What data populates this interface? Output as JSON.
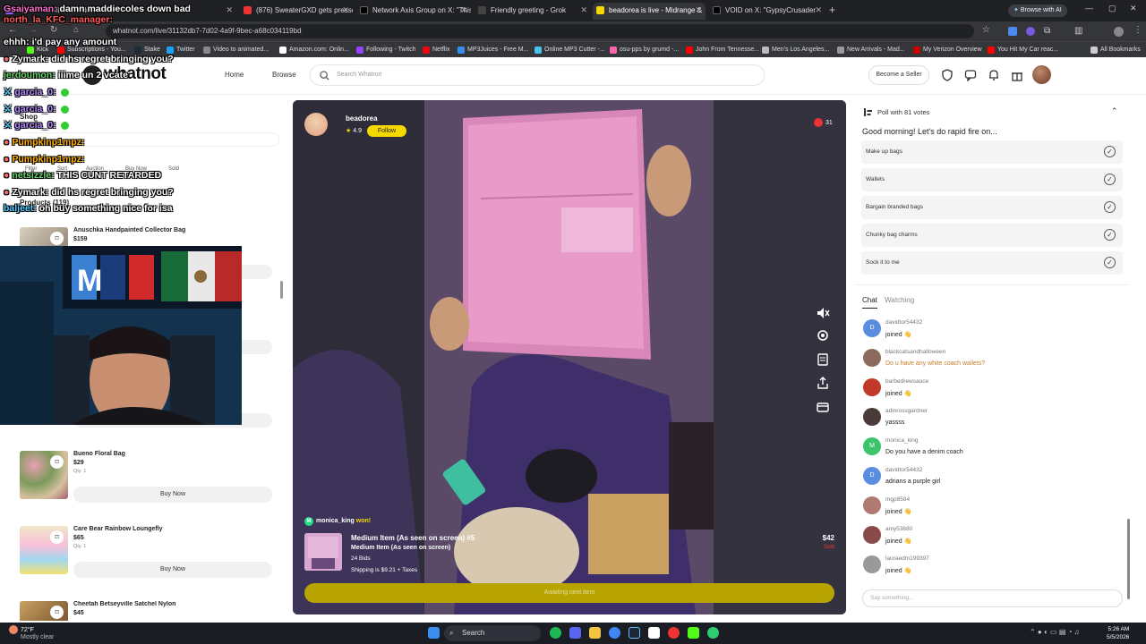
{
  "browser": {
    "tabs": [
      {
        "title": "Watch maddiecoles down bad",
        "color": "#8a5cf6"
      },
      {
        "title": "(876) SweaterGXD gets pressed",
        "color": "#e33"
      },
      {
        "title": "Network Axis Group on X: \"This",
        "color": "#000"
      },
      {
        "title": "Friendly greeting - Grok",
        "color": "#444"
      },
      {
        "title": "beadorea is live - Midrange & ",
        "color": "#f5d800"
      },
      {
        "title": "VOID on X: \"GypsyCrusader",
        "color": "#000"
      }
    ],
    "active_tab": 4,
    "browse_ai": "Browse with AI",
    "url": "whatnot.com/live/31132db7-7d02-4a9f-9bec-a68c034119bd",
    "bookmarks": [
      "Kick",
      "Subscriptions - You...",
      "Stake",
      "Twitter",
      "Video to animated...",
      "Amazon.com: Onlin...",
      "Following - Twitch",
      "Netflix",
      "MP3Juices - Free M...",
      "Online MP3 Cutter -...",
      "osu-pps by grumd -...",
      "John From Tennesse...",
      "Men's Los Angeles...",
      "New Arrivals - Mad...",
      "My Verizon Overview",
      "You Hit My Car reac...",
      "All Bookmarks"
    ]
  },
  "site": {
    "logo": "whatnot",
    "nav": {
      "home": "Home",
      "browse": "Browse"
    },
    "search_placeholder": "Search Whatnot",
    "seller_button": "Become a Seller"
  },
  "left": {
    "shop_label": "Shop",
    "filters": [
      "Filter",
      "Sort",
      "Auction",
      "Buy Now",
      "Sold"
    ],
    "products_count": "Products (119)",
    "products": [
      {
        "name": "Anuschka Handpainted Collector Bag",
        "price": "$159",
        "qty": "",
        "buy": ""
      },
      {
        "name": "Bueno Floral Bag",
        "price": "$29",
        "qty": "Qty. 1",
        "buy": "Buy Now"
      },
      {
        "name": "Care Bear Rainbow Loungefly",
        "price": "$65",
        "qty": "Qty. 1",
        "buy": "Buy Now"
      },
      {
        "name": "Cheetah Betseyville Satchel Nylon",
        "price": "$45",
        "qty": "",
        "buy": ""
      }
    ]
  },
  "overlay_chat": [
    {
      "user": "Gsaiyaman:",
      "msg": "damn maddiecoles down bad",
      "ucolor": "#ff6fd0"
    },
    {
      "user": "north_la_KFC_manager:",
      "msg": "",
      "ucolor": "#ff5a5a"
    },
    {
      "user": "ehhh:",
      "msg": "i'd pay any amount",
      "ucolor": "#ffffff"
    },
    {
      "user": "Zymark:",
      "msg": "did hs regret bringing you?",
      "ucolor": "#ffffff"
    },
    {
      "user": "jerdoumon:",
      "msg": "iiime un 2 vcate",
      "ucolor": "#6bd66b"
    },
    {
      "user": "garcia_0:",
      "msg": "",
      "ucolor": "#b48cff"
    },
    {
      "user": "garcia_0:",
      "msg": "",
      "ucolor": "#b48cff"
    },
    {
      "user": "garcia_0:",
      "msg": "",
      "ucolor": "#b48cff"
    },
    {
      "user": "Pumpkinp1mpz:",
      "msg": "",
      "ucolor": "#ffb000"
    },
    {
      "user": "Pumpkinp1mpz:",
      "msg": "",
      "ucolor": "#ffb000"
    },
    {
      "user": "netsizzle:",
      "msg": "THIS CUNT RETARDED",
      "ucolor": "#6bd66b"
    },
    {
      "user": "Zymark:",
      "msg": "did hs regret bringing you?",
      "ucolor": "#ffffff"
    },
    {
      "user": "baljeet:",
      "msg": "oh buy something nice for isa",
      "ucolor": "#5cf"
    }
  ],
  "stream": {
    "host": "beadorea",
    "rating": "4.9",
    "follow_label": "Follow",
    "viewers": "31",
    "winner": "monica_king",
    "won_label": "won!",
    "item_title": "Medium Item (As seen on screen) #5",
    "item_subtitle": "Medium Item (As seen on screen)",
    "bids": "24 Bids",
    "shipping": "Shipping is $9.21 + Taxes",
    "price": "$42",
    "status": "Sold",
    "awaiting": "Awaiting next item",
    "controls": [
      "mute-icon",
      "settings-icon",
      "notes-icon",
      "share-icon",
      "wallet-icon"
    ]
  },
  "poll": {
    "title": "Poll with 81 votes",
    "question": "Good morning! Let's do rapid fire on...",
    "options": [
      "Make up bags",
      "Wallets",
      "Bargain branded bags",
      "Chunky bag charms",
      "Sock it to me"
    ]
  },
  "chat": {
    "tabs": [
      "Chat",
      "Watching"
    ],
    "messages": [
      {
        "user": "davidtor54432",
        "msg": "joined 👋",
        "initial": "D",
        "color": "#5a8de0",
        "question": false
      },
      {
        "user": "blackcatsandhalloween",
        "msg": "Do u have any white coach wallets?",
        "initial": "",
        "color": "#8a6a5a",
        "question": true
      },
      {
        "user": "barbedrewsauce",
        "msg": "joined 👋",
        "initial": "",
        "color": "#c0392b",
        "question": false
      },
      {
        "user": "adinrossgardner",
        "msg": "yassss",
        "initial": "",
        "color": "#4a3a3a",
        "question": false
      },
      {
        "user": "monica_king",
        "msg": "Do you have a denim coach",
        "initial": "M",
        "color": "#3cc46c",
        "question": false
      },
      {
        "user": "davidtor54432",
        "msg": "adrians a purple girl",
        "initial": "D",
        "color": "#5a8de0",
        "question": false
      },
      {
        "user": "mgp8584",
        "msg": "joined 👋",
        "initial": "",
        "color": "#b07a70",
        "question": false
      },
      {
        "user": "amy53680",
        "msg": "joined 👋",
        "initial": "",
        "color": "#8a4a4a",
        "question": false
      },
      {
        "user": "lauraedm199397",
        "msg": "joined 👋",
        "initial": "",
        "color": "#999",
        "question": false
      }
    ],
    "placeholder": "Say something..."
  },
  "taskbar": {
    "temp": "72°F",
    "weather": "Mostly clear",
    "search": "Search",
    "time": "5:26 AM",
    "date": "5/5/2026"
  }
}
